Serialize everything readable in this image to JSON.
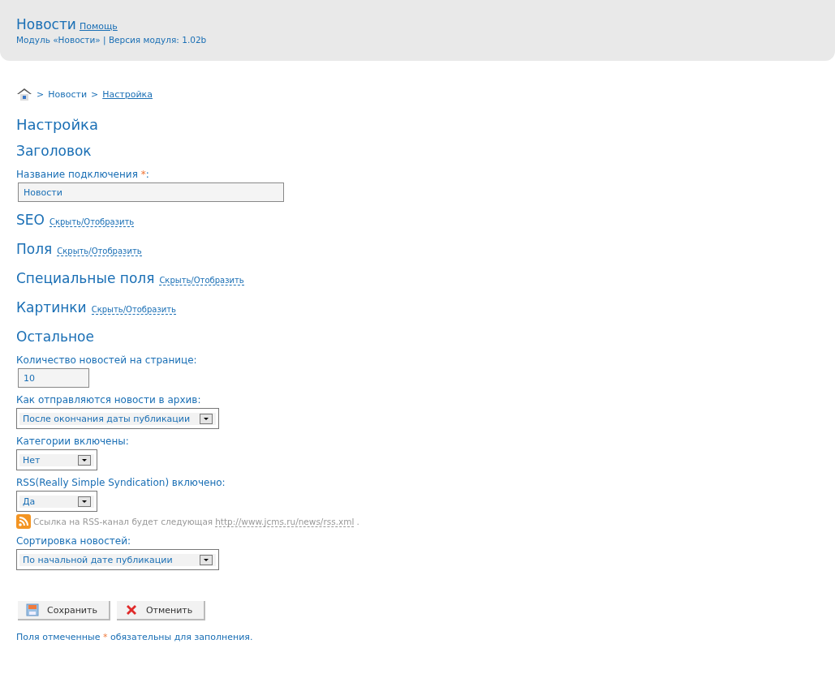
{
  "header": {
    "title": "Новости",
    "help_link": "Помощь",
    "subtitle": "Модуль «Новости» | Версия модуля: 1.02b"
  },
  "breadcrumb": [
    {
      "kind": "separator",
      "label": ">"
    },
    {
      "kind": "text",
      "label": "Новости"
    },
    {
      "kind": "separator",
      "label": ">"
    },
    {
      "kind": "link",
      "label": "Настройка"
    }
  ],
  "page_title": "Настройка",
  "sections": [
    {
      "title": "Заголовок",
      "fields": [
        {
          "kind": "text",
          "label": "Название подключения",
          "required_mark": "*",
          "label_suffix": ":",
          "value": "Новости"
        }
      ]
    },
    {
      "title": "SEO",
      "toggle": "Скрыть/Отобразить"
    },
    {
      "title": "Поля",
      "toggle": "Скрыть/Отобразить"
    },
    {
      "title": "Специальные поля",
      "toggle": "Скрыть/Отобразить"
    },
    {
      "title": "Картинки",
      "toggle": "Скрыть/Отобразить"
    },
    {
      "title": "Остальное",
      "fields": [
        {
          "kind": "text",
          "label": "Количество новостей на странице:",
          "value": "10"
        },
        {
          "kind": "select",
          "label": "Как отправляются новости в архив:",
          "value": "После окончания даты публикации"
        },
        {
          "kind": "select",
          "label": "Категории включены:",
          "value": "Нет"
        },
        {
          "kind": "select",
          "label": "RSS(Really Simple Syndication) включено:",
          "value": "Да",
          "note": {
            "text": "Ссылка на RSS-канал будет следующая",
            "link": "http://www.jcms.ru/news/rss.xml",
            "end": "."
          }
        },
        {
          "kind": "select",
          "label": "Сортировка новостей:",
          "value": "По начальной дате публикации"
        }
      ]
    }
  ],
  "buttons": [
    {
      "kind": "save",
      "label": "Сохранить"
    },
    {
      "kind": "cancel",
      "label": "Отменить"
    }
  ],
  "footer_note": {
    "before": "Поля отмеченные",
    "mark": "*",
    "after": "обязательны для заполнения."
  }
}
